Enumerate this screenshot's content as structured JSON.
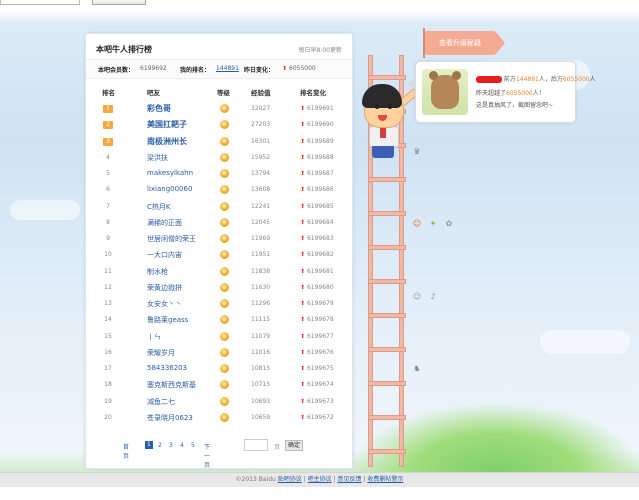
{
  "panel": {
    "title": "本吧牛人排行榜",
    "update_note": "每日早8:00更新",
    "stats": {
      "members_label": "本吧会员数：",
      "members_value": "6199692",
      "myrank_label": "我的排名：",
      "myrank_value": "144891",
      "yesterday_label": "昨日变化：",
      "yesterday_value": "6055000"
    },
    "headers": {
      "rank": "排名",
      "name": "吧友",
      "level": "等级",
      "exp": "经验值",
      "change": "排名变化"
    },
    "rows": [
      {
        "rank": "1",
        "name": "彩色哥",
        "exp": "32027",
        "change": "6199691"
      },
      {
        "rank": "2",
        "name": "美国扛耙子",
        "exp": "27203",
        "change": "6199690"
      },
      {
        "rank": "3",
        "name": "南极洲州长",
        "exp": "16301",
        "change": "6199689"
      },
      {
        "rank": "4",
        "name": "梁洪扶",
        "exp": "15952",
        "change": "6199688"
      },
      {
        "rank": "5",
        "name": "makesylkahn",
        "exp": "13794",
        "change": "6199687"
      },
      {
        "rank": "6",
        "name": "lixiang00060",
        "exp": "13608",
        "change": "6199686"
      },
      {
        "rank": "7",
        "name": "C热月K",
        "exp": "12241",
        "change": "6199685"
      },
      {
        "rank": "8",
        "name": "满稀的正面",
        "exp": "12045",
        "change": "6199684"
      },
      {
        "rank": "9",
        "name": "世居闲僧的荣王",
        "exp": "11969",
        "change": "6199683"
      },
      {
        "rank": "10",
        "name": "一大口内宙",
        "exp": "11951",
        "change": "6199682"
      },
      {
        "rank": "11",
        "name": "制水枪",
        "exp": "11838",
        "change": "6199681"
      },
      {
        "rank": "12",
        "name": "荣黄边戮拼",
        "exp": "11630",
        "change": "6199680"
      },
      {
        "rank": "13",
        "name": "女安女丶丶",
        "exp": "11296",
        "change": "6199679"
      },
      {
        "rank": "14",
        "name": "鲁路莱geass",
        "exp": "11115",
        "change": "6199678"
      },
      {
        "rank": "15",
        "name": "丨ㄣ",
        "exp": "11079",
        "change": "6199677"
      },
      {
        "rank": "16",
        "name": "荣耀岁月",
        "exp": "11016",
        "change": "6199676"
      },
      {
        "rank": "17",
        "name": "584336203",
        "exp": "10815",
        "change": "6199675"
      },
      {
        "rank": "18",
        "name": "塞克斯西克斯基",
        "exp": "10715",
        "change": "6199674"
      },
      {
        "rank": "19",
        "name": "减鱼二七",
        "exp": "10693",
        "change": "6199673"
      },
      {
        "rank": "20",
        "name": "苍录晓月0623",
        "exp": "10659",
        "change": "6199672"
      }
    ],
    "pager": {
      "home": "首页",
      "p1": "1",
      "p2": "2",
      "p3": "3",
      "p4": "4",
      "p5": "5",
      "next": "下一页",
      "page_unit": "页",
      "go": "确定"
    }
  },
  "flag_label": "查看升级秘籍",
  "bubble": {
    "l1a": "前方",
    "l1b": "144891",
    "l1c": "人，后方",
    "l1d": "6055000",
    "l1e": "人",
    "l2a": "昨天超越了",
    "l2b": "6055000",
    "l2c": "人！",
    "l3": "这是真抽风了，截图留念吧~"
  },
  "footer": {
    "copyright": "©2013 Baidu",
    "l1": "贴吧协议",
    "l2": "吧主协议",
    "l3": "意见反馈",
    "l4": "收费删帖警示"
  },
  "colors": {
    "link": "#2b5ea8",
    "up_arrow": "#e8382e",
    "top_rank_badge": "#f7a841",
    "flag": "#f4ab94"
  }
}
